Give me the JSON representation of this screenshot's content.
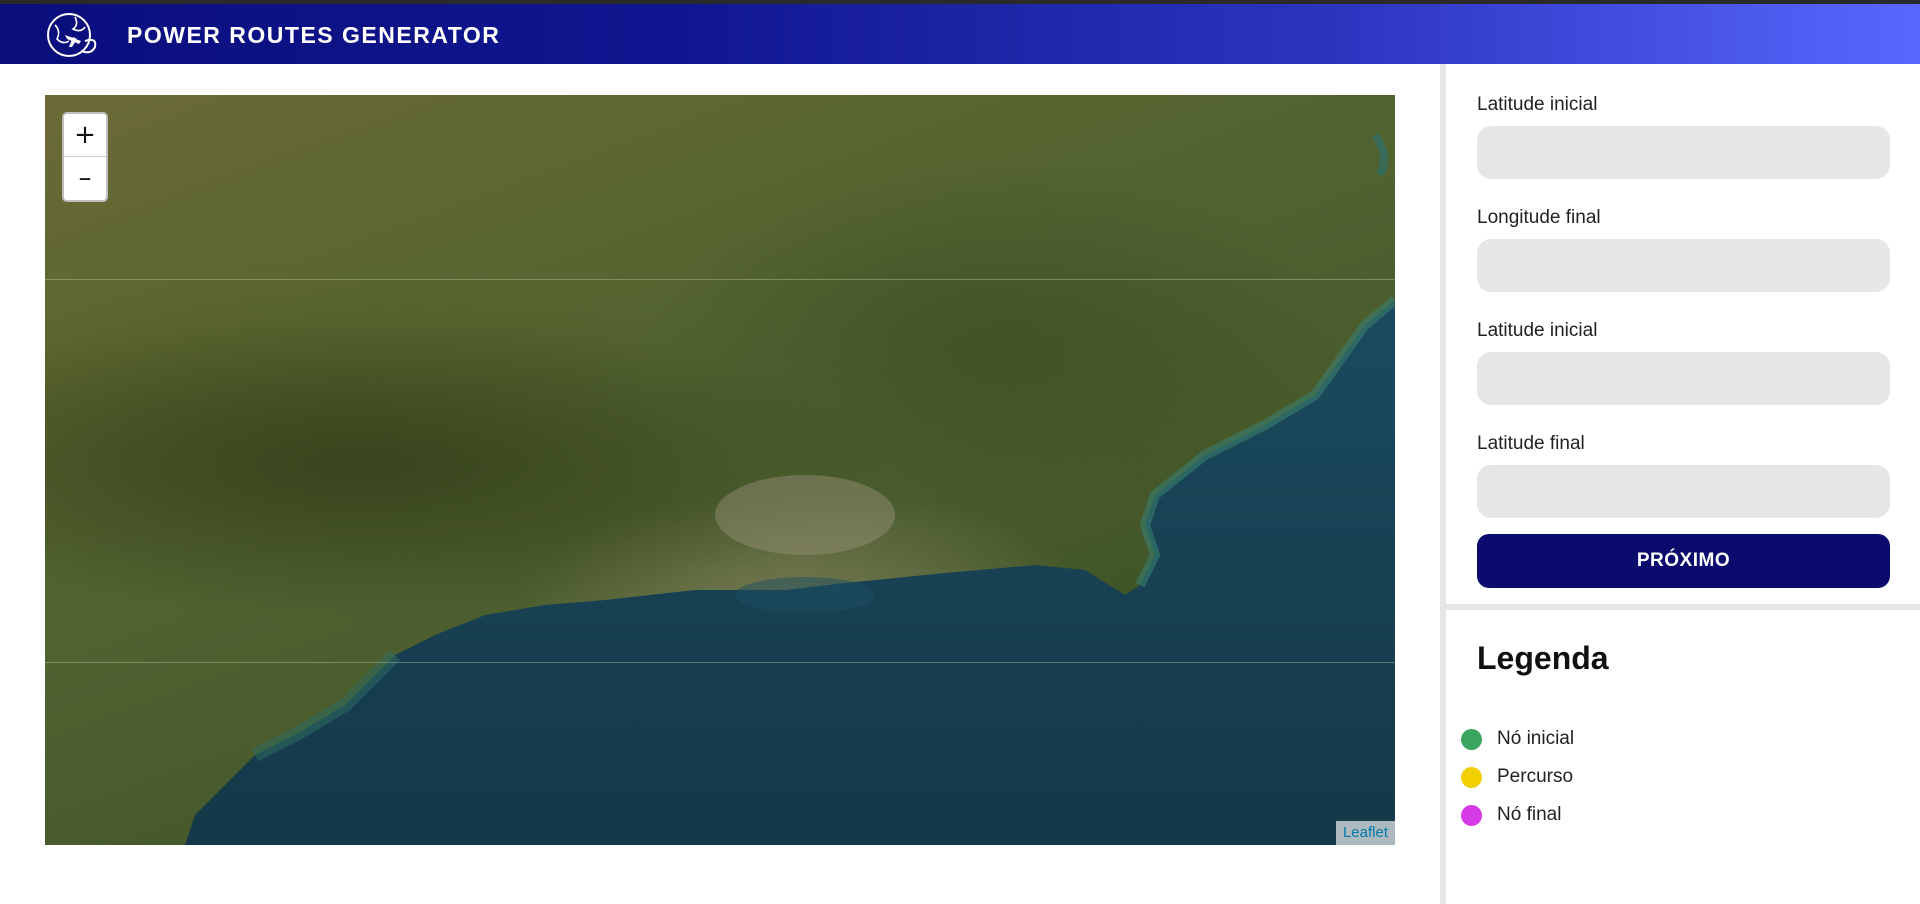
{
  "header": {
    "title": "POWER ROUTES GENERATOR",
    "logo_icon": "globe-plane-icon"
  },
  "map": {
    "zoom_in_label": "+",
    "zoom_out_label": "–",
    "attribution": "Leaflet",
    "attribution_color": "#0078a8"
  },
  "form": {
    "fields": [
      {
        "label": "Latitude inicial",
        "value": "",
        "placeholder": ""
      },
      {
        "label": "Longitude final",
        "value": "",
        "placeholder": ""
      },
      {
        "label": "Latitude inicial",
        "value": "",
        "placeholder": ""
      },
      {
        "label": "Latitude final",
        "value": "",
        "placeholder": ""
      }
    ],
    "submit_label": "PRÓXIMO",
    "submit_color": "#0b0b6e"
  },
  "legend": {
    "title": "Legenda",
    "items": [
      {
        "label": "Nó inicial",
        "color": "#3aa55e"
      },
      {
        "label": "Percurso",
        "color": "#f2cf00"
      },
      {
        "label": "Nó final",
        "color": "#d63ae6"
      }
    ]
  },
  "colors": {
    "header_start": "#0a0e7c",
    "header_end": "#5868ff"
  }
}
